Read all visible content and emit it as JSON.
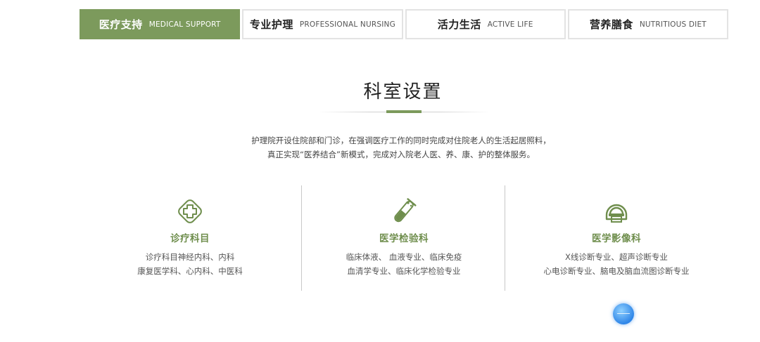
{
  "tabs": [
    {
      "zh": "医疗支持",
      "en": "MEDICAL SUPPORT",
      "active": true
    },
    {
      "zh": "专业护理",
      "en": "PROFESSIONAL NURSING",
      "active": false
    },
    {
      "zh": "活力生活",
      "en": "ACTIVE LIFE",
      "active": false
    },
    {
      "zh": "营养膳食",
      "en": "NUTRITIOUS DIET",
      "active": false
    }
  ],
  "section": {
    "title": "科室设置",
    "intro_line1": "护理院开设住院部和门诊，在强调医疗工作的同时完成对住院老人的生活起居照料，",
    "intro_line2": "真正实现“医养结合”新模式，完成对入院老人医、养、康、护的整体服务。"
  },
  "departments": [
    {
      "name": "诊疗科目",
      "icon": "medical-cross-icon",
      "line1": "诊疗科目神经内科、内科",
      "line2": "康复医学科、心内科、中医科"
    },
    {
      "name": "医学检验科",
      "icon": "test-tube-icon",
      "line1": "临床体液、 血液专业、临床免疫",
      "line2": "血清学专业、临床化学检验专业"
    },
    {
      "name": "医学影像科",
      "icon": "ct-scanner-icon",
      "line1": "X线诊断专业、超声诊断专业",
      "line2": "心电诊断专业、脑电及脑血流图诊断专业"
    }
  ],
  "colors": {
    "accent": "#7c9a5c",
    "text_accent": "#6f8e4d",
    "float": "#2f86e8"
  }
}
